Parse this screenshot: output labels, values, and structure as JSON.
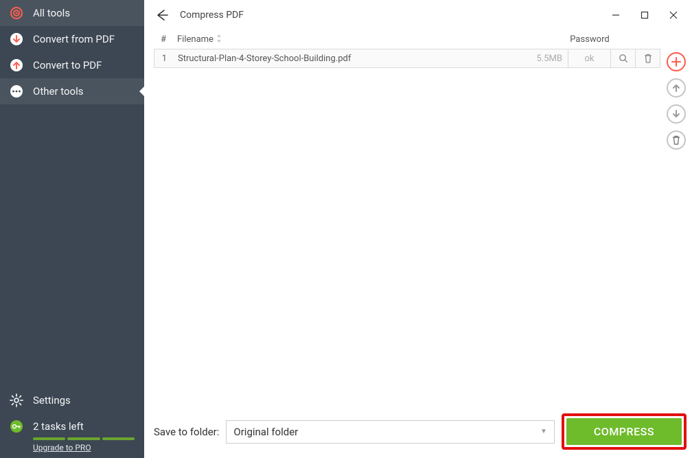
{
  "sidebar": {
    "items": [
      {
        "label": "All tools",
        "icon": "target"
      },
      {
        "label": "Convert from PDF",
        "icon": "arrow-down"
      },
      {
        "label": "Convert to PDF",
        "icon": "arrow-up"
      },
      {
        "label": "Other tools",
        "icon": "dots"
      }
    ],
    "settings_label": "Settings",
    "tasks_label": "2 tasks left",
    "upgrade_label": "Upgrade to PRO"
  },
  "header": {
    "title": "Compress PDF"
  },
  "table": {
    "col_idx": "#",
    "col_filename": "Filename",
    "col_password": "Password",
    "rows": [
      {
        "idx": "1",
        "name": "Structural-Plan-4-Storey-School-Building.pdf",
        "size": "5.5MB",
        "password": "ok"
      }
    ]
  },
  "footer": {
    "save_label": "Save to folder:",
    "folder_value": "Original folder",
    "button_label": "COMPRESS"
  }
}
